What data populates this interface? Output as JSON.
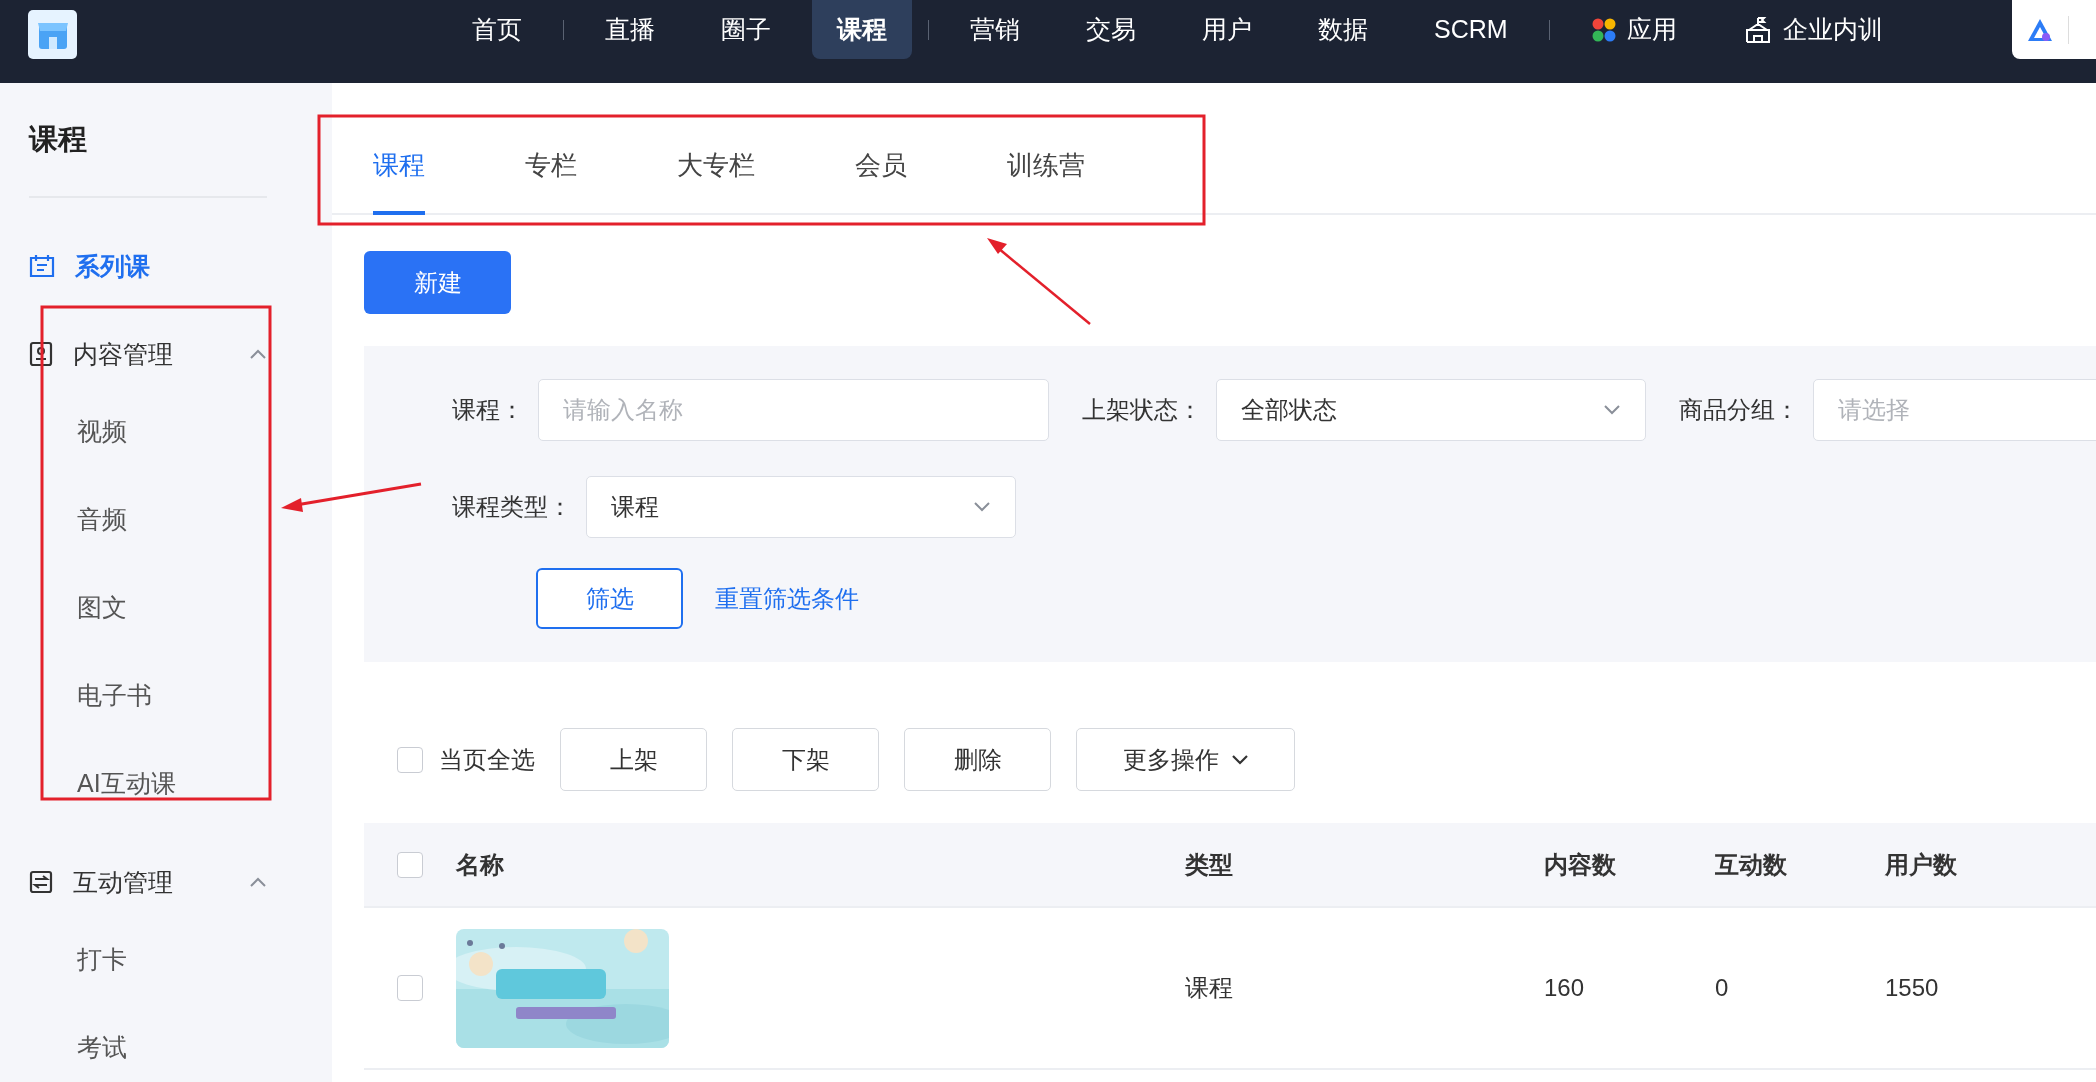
{
  "topnav": {
    "items": [
      {
        "kind": "link",
        "label": "首页",
        "selected": false
      },
      {
        "kind": "divider"
      },
      {
        "kind": "link",
        "label": "直播",
        "selected": false
      },
      {
        "kind": "link",
        "label": "圈子",
        "selected": false
      },
      {
        "kind": "link",
        "label": "课程",
        "selected": true
      },
      {
        "kind": "divider"
      },
      {
        "kind": "link",
        "label": "营销",
        "selected": false
      },
      {
        "kind": "link",
        "label": "交易",
        "selected": false
      },
      {
        "kind": "link",
        "label": "用户",
        "selected": false
      },
      {
        "kind": "link",
        "label": "数据",
        "selected": false
      },
      {
        "kind": "link",
        "label": "SCRM",
        "selected": false
      },
      {
        "kind": "divider"
      },
      {
        "kind": "apps",
        "label": "应用",
        "selected": false
      },
      {
        "kind": "training",
        "label": "企业内训",
        "selected": false
      }
    ]
  },
  "sidebar": {
    "title": "课程",
    "items": [
      {
        "kind": "link",
        "label": "系列课",
        "selected": true
      },
      {
        "kind": "group",
        "label": "内容管理",
        "expanded": true,
        "children": [
          {
            "label": "视频",
            "selected": false
          },
          {
            "label": "音频",
            "selected": false
          },
          {
            "label": "图文",
            "selected": false
          },
          {
            "label": "电子书",
            "selected": false
          },
          {
            "label": "AI互动课",
            "selected": false
          }
        ]
      },
      {
        "kind": "group",
        "label": "互动管理",
        "expanded": true,
        "children": [
          {
            "label": "打卡",
            "selected": false
          },
          {
            "label": "考试",
            "selected": false
          }
        ]
      }
    ]
  },
  "tabs": [
    {
      "label": "课程",
      "selected": true
    },
    {
      "label": "专栏",
      "selected": false
    },
    {
      "label": "大专栏",
      "selected": false
    },
    {
      "label": "会员",
      "selected": false
    },
    {
      "label": "训练营",
      "selected": false
    }
  ],
  "new_button": "新建",
  "filters": {
    "rows": [
      [
        {
          "kind": "input",
          "label": "课程：",
          "placeholder": "请输入名称"
        },
        {
          "kind": "select",
          "label": "上架状态：",
          "value": "全部状态"
        },
        {
          "kind": "input",
          "label": "商品分组：",
          "placeholder": "请选择"
        }
      ],
      [
        {
          "kind": "select",
          "label": "课程类型：",
          "value": "课程"
        }
      ]
    ],
    "filter_button": "筛选",
    "reset_link": "重置筛选条件"
  },
  "batch": {
    "select_all": {
      "label": "当页全选",
      "checked": false
    },
    "buttons": [
      "上架",
      "下架",
      "删除"
    ],
    "more": "更多操作"
  },
  "table": {
    "header_checked": false,
    "columns": [
      "名称",
      "类型",
      "内容数",
      "互动数",
      "用户数"
    ],
    "rows": [
      {
        "checked": false,
        "cells": [
          "",
          "课程",
          "160",
          "0",
          "1550"
        ]
      }
    ]
  }
}
